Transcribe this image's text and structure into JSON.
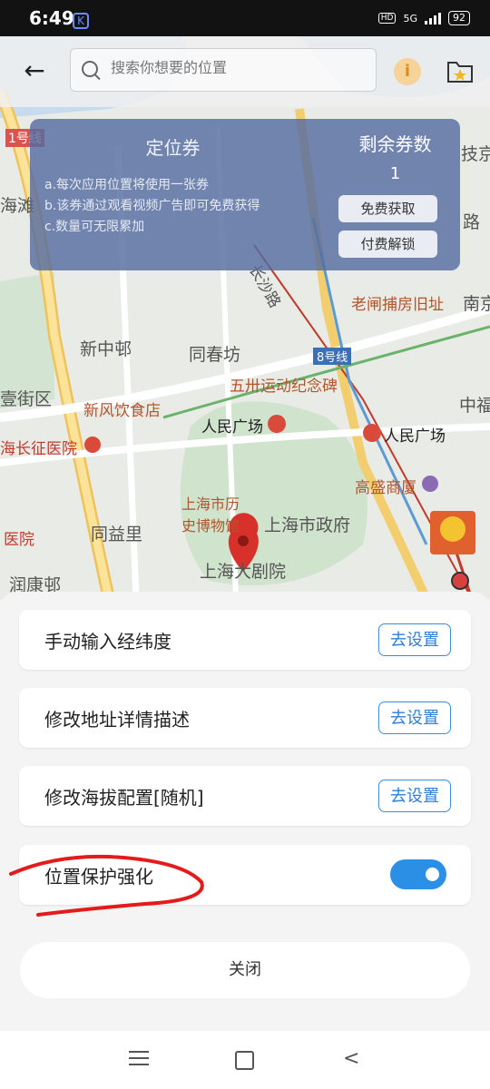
{
  "status_bar": {
    "time": "6:49",
    "app_icon": "K",
    "hd": "HD",
    "network": "5G",
    "battery": "92"
  },
  "top_bar": {
    "search_placeholder": "搜索你想要的位置",
    "info_icon": "i"
  },
  "map": {
    "labels": {
      "line1": "1号线",
      "hai_tan": "海滩",
      "ji_jing": "技京",
      "lu": "路",
      "chang_sha_lu": "长沙路",
      "lao_zha": "老闸捕房旧址",
      "nan_jing": "南京",
      "xin_zhong_li": "新中邨",
      "tong_chun_fang": "同春坊",
      "line8": "8号线",
      "wu_sa": "五卅运动纪念碑",
      "yi_jie_qu": "壹街区",
      "xin_feng": "新风饮食店",
      "zhong_fu": "中福",
      "renmin_1": "人民广场",
      "renmin_2": "人民广场",
      "changzheng": "海长征医院",
      "gaosheng": "高盛商厦",
      "museum_1": "上海市历",
      "museum_2": "史博物馆",
      "gov": "上海市政府",
      "yi_yuan": "医院",
      "tong_yi_li": "同益里",
      "grand_theatre": "上海大剧院",
      "run_kang": "润康邨"
    }
  },
  "coupon": {
    "title": "定位券",
    "rules": [
      "a.每次应用位置将使用一张券",
      "b.该券通过观看视频广告即可免费获得",
      "c.数量可无限累加"
    ],
    "remain_title": "剩余券数",
    "remain_count": "1",
    "free_button": "免费获取",
    "paid_button": "付费解锁"
  },
  "sheet": {
    "rows": [
      {
        "label": "手动输入经纬度",
        "button": "去设置"
      },
      {
        "label": "修改地址详情描述",
        "button": "去设置"
      },
      {
        "label": "修改海拔配置[随机]",
        "button": "去设置"
      }
    ],
    "protection_label": "位置保护强化",
    "protection_enabled": true,
    "close_label": "关闭"
  },
  "colors": {
    "accent": "#2b8fe6",
    "panel": "#566da0",
    "scribble": "#e31b1b"
  }
}
